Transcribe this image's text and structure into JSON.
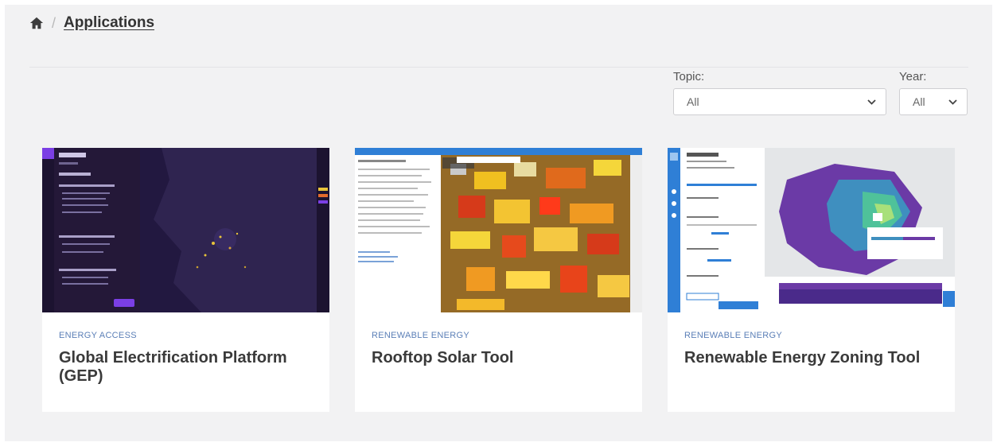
{
  "breadcrumb": {
    "home_icon": "home-icon",
    "separator": "/",
    "current": "Applications"
  },
  "filters": {
    "topic": {
      "label": "Topic:",
      "value": "All"
    },
    "year": {
      "label": "Year:",
      "value": "All"
    }
  },
  "cards": [
    {
      "topic": "ENERGY ACCESS",
      "title": "Global Electrification Platform (GEP)"
    },
    {
      "topic": "RENEWABLE ENERGY",
      "title": "Rooftop Solar Tool"
    },
    {
      "topic": "RENEWABLE ENERGY",
      "title": "Renewable Energy Zoning Tool"
    }
  ],
  "colors": {
    "background": "#f2f2f3",
    "card": "#ffffff",
    "topic": "#5b7fb7",
    "title": "#3a3a3a"
  }
}
